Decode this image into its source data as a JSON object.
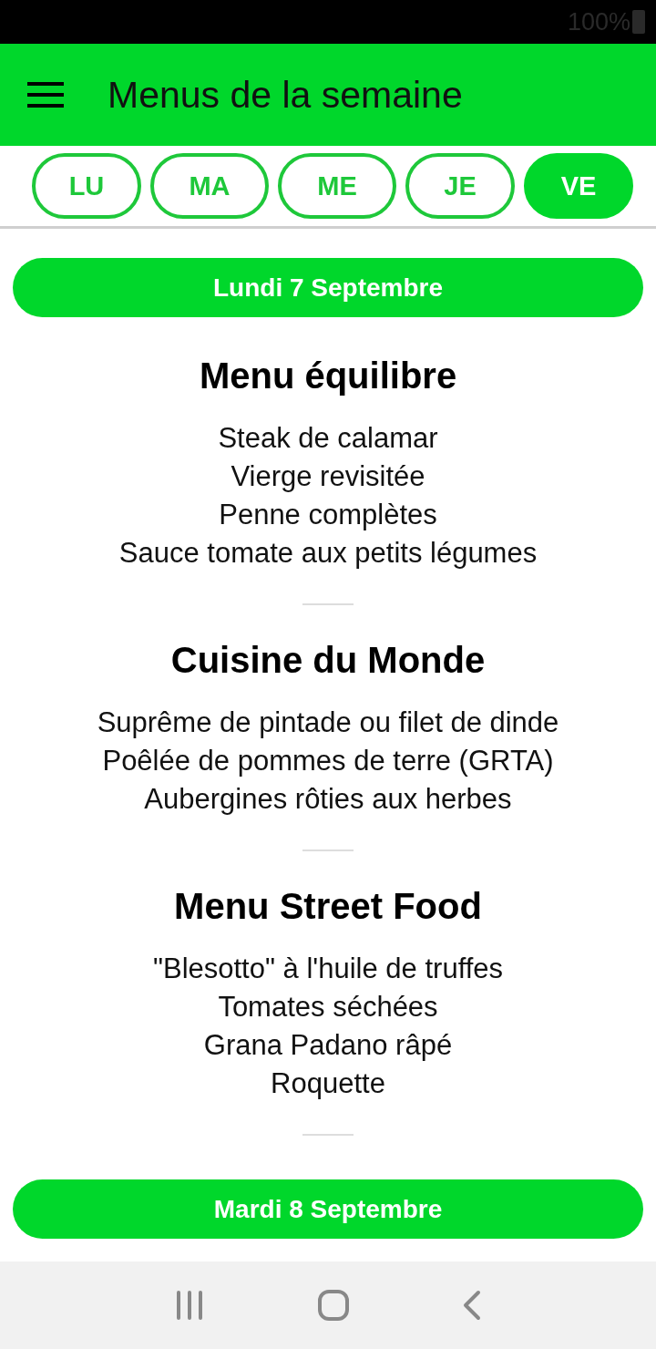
{
  "status_bar": {
    "battery": "100%"
  },
  "app_bar": {
    "title": "Menus de la semaine"
  },
  "day_tabs": [
    {
      "label": "LU",
      "selected": false
    },
    {
      "label": "MA",
      "selected": false
    },
    {
      "label": "ME",
      "selected": false
    },
    {
      "label": "JE",
      "selected": false
    },
    {
      "label": "VE",
      "selected": true
    }
  ],
  "days": [
    {
      "date": "Lundi 7 Septembre",
      "menus": [
        {
          "title": "Menu équilibre",
          "items": [
            "Steak de calamar",
            "Vierge revisitée",
            "Penne complètes",
            "Sauce tomate aux petits légumes"
          ]
        },
        {
          "title": "Cuisine du Monde",
          "items": [
            "Suprême de pintade ou filet de dinde",
            "Poêlée de pommes de terre (GRTA)",
            "Aubergines rôties aux herbes"
          ]
        },
        {
          "title": "Menu Street Food",
          "items": [
            "\"Blesotto\" à l'huile de truffes",
            "Tomates séchées",
            "Grana Padano râpé",
            "Roquette"
          ]
        }
      ]
    },
    {
      "date": "Mardi 8 Septembre"
    }
  ]
}
